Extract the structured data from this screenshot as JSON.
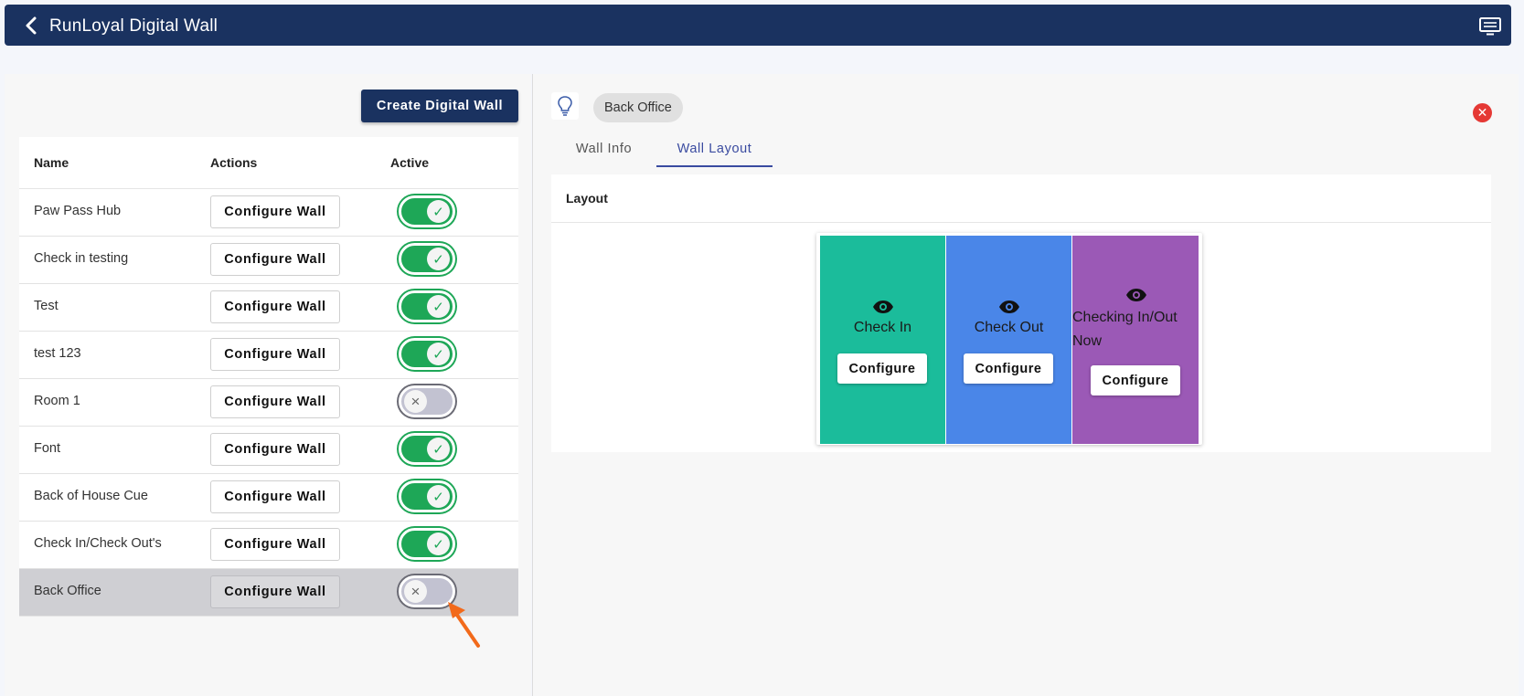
{
  "header": {
    "title": "RunLoyal Digital Wall",
    "back_icon": "chevron-left-icon",
    "menu_icon": "monitor-icon"
  },
  "left": {
    "create_button": "Create Digital Wall",
    "columns": {
      "name": "Name",
      "actions": "Actions",
      "active": "Active"
    },
    "rows": [
      {
        "name": "Paw Pass Hub",
        "action": "Configure Wall",
        "active": true
      },
      {
        "name": "Check in testing",
        "action": "Configure Wall",
        "active": true
      },
      {
        "name": "Test",
        "action": "Configure Wall",
        "active": true
      },
      {
        "name": "test 123",
        "action": "Configure Wall",
        "active": true
      },
      {
        "name": "Room 1",
        "action": "Configure Wall",
        "active": false
      },
      {
        "name": "Font",
        "action": "Configure Wall",
        "active": true
      },
      {
        "name": "Back of House Cue",
        "action": "Configure Wall",
        "active": true
      },
      {
        "name": "Check In/Check Out's",
        "action": "Configure Wall",
        "active": true
      },
      {
        "name": "Back Office",
        "action": "Configure Wall",
        "active": false,
        "selected": true
      }
    ]
  },
  "right": {
    "wall_name": "Back Office",
    "tabs": [
      "Wall Info",
      "Wall Layout"
    ],
    "active_tab": "Wall Layout",
    "layout_heading": "Layout",
    "zones": [
      {
        "label": "Check In",
        "button": "Configure",
        "color": "#1bbc9b"
      },
      {
        "label": "Check Out",
        "button": "Configure",
        "color": "#4a86e8"
      },
      {
        "label": "Checking In/Out Now",
        "button": "Configure",
        "color": "#9b59b6"
      }
    ]
  },
  "colors": {
    "header_bg": "#1a3260",
    "toggle_on": "#1ea757",
    "toggle_off": "#c2c2d1",
    "active_tab": "#3a4ba0",
    "close": "#e53935",
    "annotation_arrow": "#f26a1b"
  }
}
